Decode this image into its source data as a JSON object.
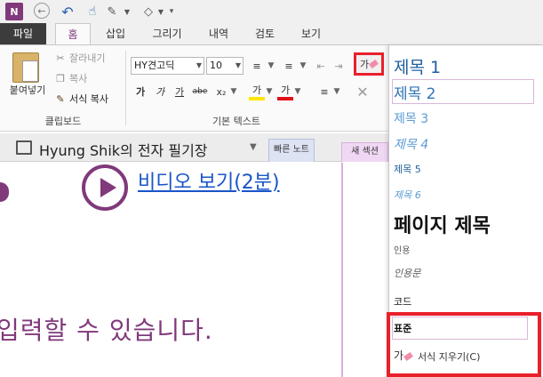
{
  "quick_access": {
    "app_icon": "N",
    "icons": [
      "onenote-icon",
      "back-icon",
      "undo-icon",
      "touch-mode-icon",
      "pen-icon",
      "shape-icon",
      "customize-icon"
    ]
  },
  "ribbon_tabs": [
    "파일",
    "홈",
    "삽입",
    "그리기",
    "내역",
    "검토",
    "보기"
  ],
  "clipboard": {
    "paste": "붙여넣기",
    "cut": "잘라내기",
    "copy": "복사",
    "format_painter": "서식 복사",
    "group_label": "클립보드"
  },
  "basic_text": {
    "font_name": "HY견고딕",
    "font_size": "10",
    "bold": "가",
    "italic": "가",
    "underline": "가",
    "strikethrough": "abe",
    "subscript": "x₂",
    "highlight": "가",
    "font_color": "가",
    "group_label": "기본 텍스트"
  },
  "clear_format_glyph": "가",
  "styles": {
    "h1": "제목 1",
    "h2": "제목 2",
    "h3": "제목 3",
    "h4": "제목 4",
    "h5": "제목 5",
    "h6": "제목 6",
    "page_title": "페이지 제목",
    "citation": "인용",
    "quote": "인용문",
    "code": "코드",
    "normal": "표준",
    "clear_formatting": "서식 지우기(C)",
    "clear_icon_glyph": "가"
  },
  "notebook": {
    "title": "Hyung Shik의 전자 필기장",
    "section_quick": "빠른 노트",
    "section_new": "새 섹션"
  },
  "page": {
    "video_link": "비디오 보기(2분)",
    "body_text": "입력할 수 있습니다."
  },
  "colors": {
    "accent": "#80397b",
    "highlight_outline": "#e8202a",
    "link": "#1a55c8"
  }
}
